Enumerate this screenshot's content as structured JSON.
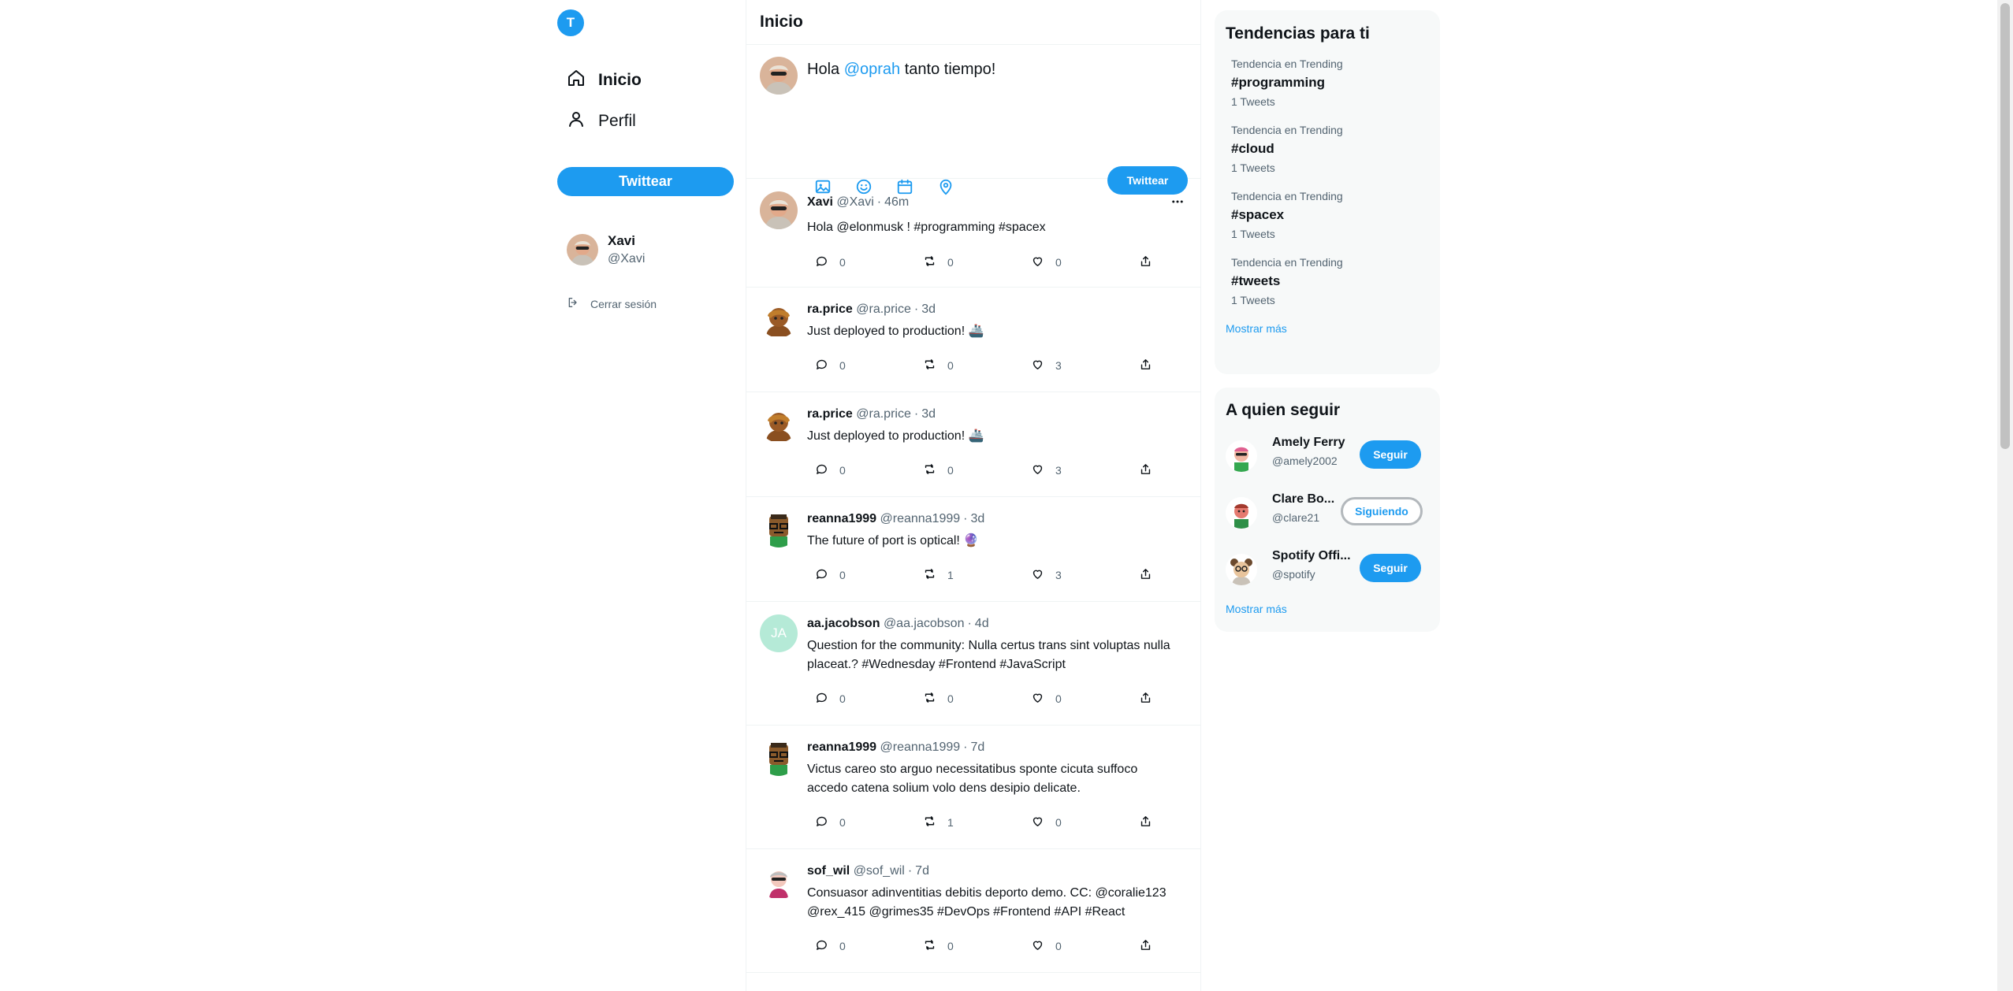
{
  "brand": {
    "logo_letter": "T",
    "accent": "#1d9bf0"
  },
  "sidebar": {
    "nav": [
      {
        "label": "Inicio",
        "icon": "home-icon"
      },
      {
        "label": "Perfil",
        "icon": "user-icon"
      }
    ],
    "tweet_button": "Twittear",
    "user": {
      "name": "Xavi",
      "handle": "@Xavi"
    },
    "logout": "Cerrar sesión"
  },
  "main": {
    "title": "Inicio",
    "composer": {
      "text_before": "Hola ",
      "mention": "@oprah",
      "text_after": " tanto tiempo!",
      "tools": [
        "image-icon",
        "emoji-icon",
        "calendar-icon",
        "location-icon"
      ],
      "submit": "Twittear"
    },
    "tweets": [
      {
        "name": "Xavi",
        "handle": "@Xavi",
        "time": "46m",
        "text": "Hola @elonmusk !  #programming #spacex",
        "replies": "0",
        "retweets": "0",
        "likes": "0"
      },
      {
        "name": "ra.price",
        "handle": "@ra.price",
        "time": "3d",
        "text": "Just deployed to production! 🚢",
        "replies": "0",
        "retweets": "0",
        "likes": "3"
      },
      {
        "name": "ra.price",
        "handle": "@ra.price",
        "time": "3d",
        "text": "Just deployed to production! 🚢",
        "replies": "0",
        "retweets": "0",
        "likes": "3"
      },
      {
        "name": "reanna1999",
        "handle": "@reanna1999",
        "time": "3d",
        "text": "The future of port is optical! 🔮",
        "replies": "0",
        "retweets": "1",
        "likes": "3"
      },
      {
        "name": "aa.jacobson",
        "handle": "@aa.jacobson",
        "time": "4d",
        "avatar_initials": "JA",
        "text": "Question for the community: Nulla certus trans sint voluptas nulla placeat.? #Wednesday #Frontend #JavaScript",
        "replies": "0",
        "retweets": "0",
        "likes": "0"
      },
      {
        "name": "reanna1999",
        "handle": "@reanna1999",
        "time": "7d",
        "text": "Victus careo sto arguo necessitatibus sponte cicuta suffoco accedo catena solium volo dens desipio delicate.",
        "replies": "0",
        "retweets": "1",
        "likes": "0"
      },
      {
        "name": "sof_wil",
        "handle": "@sof_wil",
        "time": "7d",
        "text": "Consuasor adinventitias debitis deporto demo. CC: @coralie123 @rex_415 @grimes35 #DevOps #Frontend #API #React",
        "replies": "0",
        "retweets": "0",
        "likes": "0"
      }
    ]
  },
  "trends": {
    "title": "Tendencias para ti",
    "items": [
      {
        "category": "Tendencia en Trending",
        "tag": "#programming",
        "count": "1 Tweets"
      },
      {
        "category": "Tendencia en Trending",
        "tag": "#cloud",
        "count": "1 Tweets"
      },
      {
        "category": "Tendencia en Trending",
        "tag": "#spacex",
        "count": "1 Tweets"
      },
      {
        "category": "Tendencia en Trending",
        "tag": "#tweets",
        "count": "1 Tweets"
      }
    ],
    "show_more": "Mostrar más"
  },
  "who_to_follow": {
    "title": "A quien seguir",
    "items": [
      {
        "name": "Amely Ferry",
        "handle": "@amely2002",
        "button": "Seguir"
      },
      {
        "name": "Clare Bo...",
        "handle": "@clare21",
        "button": "Siguiendo"
      },
      {
        "name": "Spotify Offi...",
        "handle": "@spotify",
        "button": "Seguir"
      }
    ],
    "show_more": "Mostrar más"
  }
}
